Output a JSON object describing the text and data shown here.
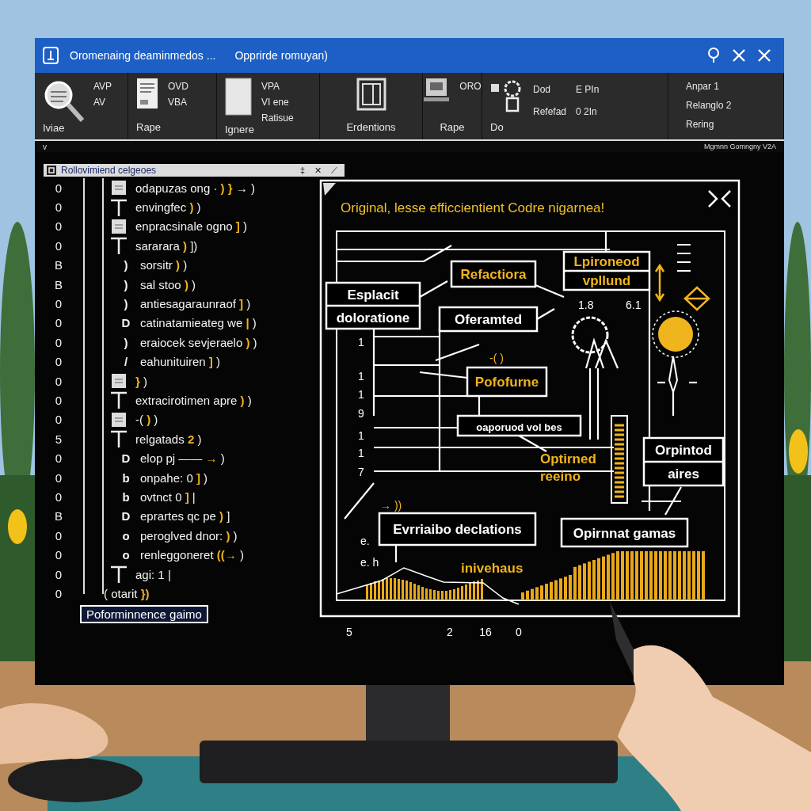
{
  "window": {
    "title": "Oromenaing deaminmedos ...",
    "subtitle": "Opprirde romuyan)"
  },
  "toolbar": [
    {
      "label": "Iviae",
      "lines": [
        "AVP",
        "AV"
      ]
    },
    {
      "label": "Rape",
      "lines": [
        "OVD",
        "VBA"
      ]
    },
    {
      "label": "Ignere",
      "lines": [
        "VPA",
        "VI ene",
        "Ratisue"
      ]
    },
    {
      "label": "Erdentions"
    },
    {
      "label": "Rape",
      "lines": [
        "ORO"
      ]
    },
    {
      "label": "Do",
      "lines": [
        "Dod",
        "Refefad"
      ],
      "lines_2": [
        "E PIn",
        "0 2In"
      ]
    },
    {
      "lines": [
        "Anpar 1",
        "Relanglo 2",
        "Rering"
      ]
    }
  ],
  "strip": {
    "toggle": "v",
    "text": "Mgmnn Gomngny V2A"
  },
  "code_panel": {
    "title": "Rollovimiend celgeoes",
    "controls": [
      "‡",
      "✕",
      "⟋"
    ],
    "lines": [
      {
        "number": "0",
        "kind": "block",
        "code": "odapuzas ong ·",
        "accent": ") }",
        "tail": "→ )"
      },
      {
        "number": "0",
        "kind": "branch",
        "code": "envingfec",
        "accent": ")",
        "tail": ")"
      },
      {
        "number": "0",
        "kind": "block",
        "code": "enpracsinale ogno",
        "accent": "]",
        "tail": ")"
      },
      {
        "number": "0",
        "kind": "branch",
        "code": "sararara",
        "accent": ")",
        "tail": "])"
      },
      {
        "number": "B",
        "kind": "marker",
        "marker": ")",
        "code": "sorsitr",
        "accent": ")",
        "tail": ")"
      },
      {
        "number": "B",
        "kind": "marker",
        "marker": ")",
        "code": "sal stoo",
        "accent": ")",
        "tail": ")"
      },
      {
        "number": "0",
        "kind": "marker",
        "marker": ")",
        "code": "antiesagaraunraof",
        "accent": "]",
        "tail": ")"
      },
      {
        "number": "0",
        "kind": "marker",
        "marker": "D",
        "code": "catinatamieateg we",
        "accent": "|",
        "tail": ")"
      },
      {
        "number": "0",
        "kind": "marker",
        "marker": ")",
        "code": "eraiocek sevjeraelo",
        "accent": ")",
        "tail": ")"
      },
      {
        "number": "0",
        "kind": "marker",
        "marker": "/",
        "code": "eahunituiren",
        "accent": "]",
        "tail": ")"
      },
      {
        "number": "0",
        "kind": "block",
        "accent": "}",
        "tail": ")"
      },
      {
        "number": "0",
        "kind": "branch",
        "code": "extracirotimen apre",
        "accent": ")",
        "tail": ")"
      },
      {
        "number": "0",
        "kind": "block",
        "code": "-(",
        "accent": ")",
        "tail": ")"
      },
      {
        "number": "5",
        "kind": "branch",
        "code": "relgatads",
        "accent": "2",
        "tail": ")"
      },
      {
        "number": "0",
        "kind": "marker",
        "marker": "D",
        "code": "elop pj ——",
        "accent": "→",
        "tail": ")"
      },
      {
        "number": "0",
        "kind": "marker",
        "marker": "b",
        "code": "onpahe: 0",
        "accent": "]",
        "tail": ")"
      },
      {
        "number": "0",
        "kind": "marker",
        "marker": "b",
        "code": "ovtnct 0",
        "accent": "]",
        "tail": "|"
      },
      {
        "number": "B",
        "kind": "marker",
        "marker": "D",
        "code": "eprartes qc pe",
        "accent": ")",
        "tail": "]"
      },
      {
        "number": "0",
        "kind": "marker",
        "marker": "o",
        "code": "peroglved dnor:",
        "accent": ")",
        "tail": ")"
      },
      {
        "number": "0",
        "kind": "marker",
        "marker": "o",
        "code": "renleggoneret",
        "accent": "((→",
        "tail": ")"
      },
      {
        "number": "0",
        "kind": "branch",
        "code": "agi: 1",
        "tail": "|"
      },
      {
        "number": "0",
        "kind": "root",
        "code": "( otarit",
        "accent": "})"
      }
    ],
    "footer": "Poforminnence gaimo"
  },
  "diagram": {
    "title": "Original, lesse efficcientient Codre nigarnea!",
    "nodes": [
      {
        "kind": "box",
        "highlighted": true,
        "lines": [
          "Refactiora"
        ]
      },
      {
        "kind": "split",
        "highlighted": false,
        "lines": [
          "Esplacit",
          "doloratione"
        ]
      },
      {
        "kind": "box",
        "highlighted": false,
        "lines": [
          "Oferamted"
        ]
      },
      {
        "kind": "split",
        "highlighted": true,
        "lines": [
          "Lpironeod",
          "vpllund"
        ]
      },
      {
        "kind": "box",
        "highlighted": true,
        "lines": [
          "Pofofurne"
        ]
      },
      {
        "kind": "box",
        "highlighted": false,
        "lines": [
          "oaporuod vol bes"
        ]
      },
      {
        "kind": "label",
        "highlighted": true,
        "lines": [
          "Optirned",
          "reeino"
        ]
      },
      {
        "kind": "split",
        "highlighted": false,
        "lines": [
          "Orpintod",
          "aires"
        ]
      },
      {
        "kind": "box",
        "highlighted": false,
        "lines": [
          "Evrriaibo declations"
        ]
      },
      {
        "kind": "box",
        "highlighted": false,
        "lines": [
          "Opirnnat gamas"
        ]
      },
      {
        "kind": "label",
        "highlighted": true,
        "lines": [
          "inivehaus"
        ]
      }
    ],
    "marks": [
      {
        "text": "1.8",
        "highlighted": false
      },
      {
        "text": "6.1",
        "highlighted": false
      },
      {
        "text": "1",
        "highlighted": false
      },
      {
        "text": "-( )",
        "highlighted": true
      },
      {
        "text": "1",
        "highlighted": false
      },
      {
        "text": "1",
        "highlighted": false
      },
      {
        "text": "9",
        "highlighted": false
      },
      {
        "text": "1",
        "highlighted": false
      },
      {
        "text": "1",
        "highlighted": false
      },
      {
        "text": "7",
        "highlighted": false
      },
      {
        "text": "→ ))",
        "highlighted": true
      },
      {
        "text": "e.",
        "highlighted": false
      },
      {
        "text": "e. h",
        "highlighted": false
      }
    ],
    "axis_ticks": [
      "5",
      "2",
      "16",
      "0"
    ]
  }
}
